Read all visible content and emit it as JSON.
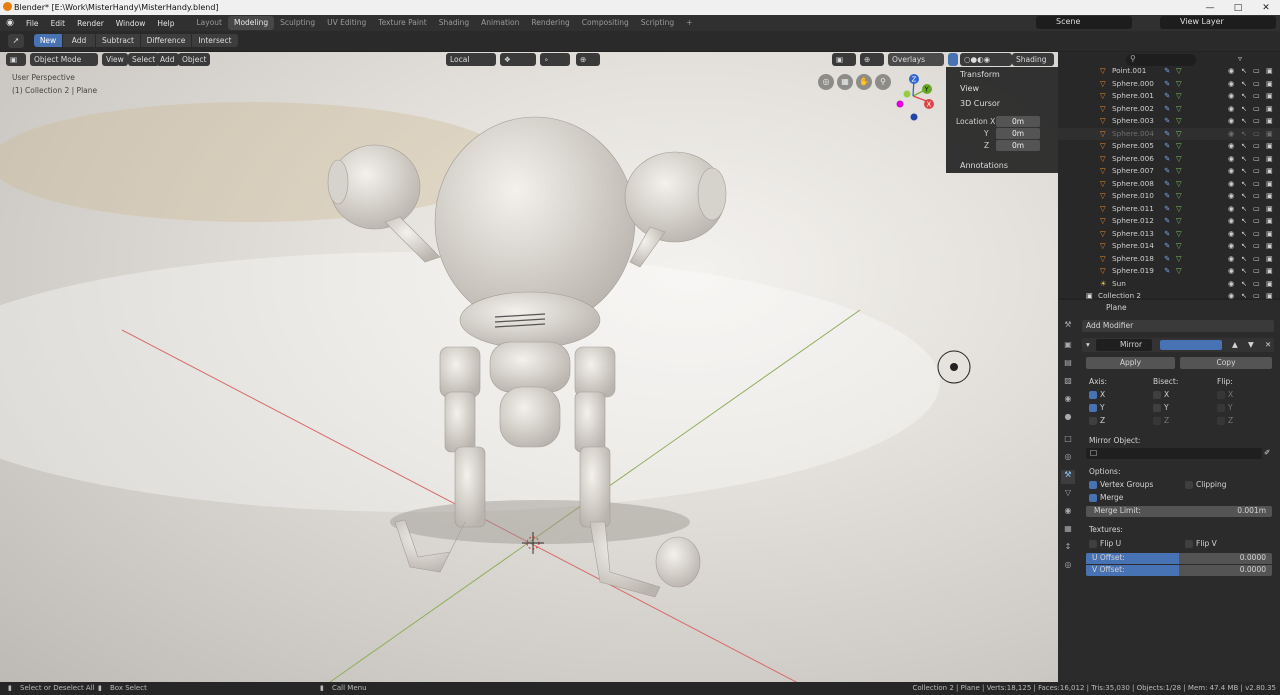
{
  "title": "Blender* [E:\\Work\\MisterHandy\\MisterHandy.blend]",
  "menus": [
    "File",
    "Edit",
    "Render",
    "Window",
    "Help"
  ],
  "workspaces": [
    "Layout",
    "Modeling",
    "Sculpting",
    "UV Editing",
    "Texture Paint",
    "Shading",
    "Animation",
    "Rendering",
    "Compositing",
    "Scripting"
  ],
  "active_workspace": "Modeling",
  "scene": "Scene",
  "view_layer": "View Layer",
  "boolean_tools": [
    "New",
    "Add",
    "Subtract",
    "Difference",
    "Intersect"
  ],
  "viewport": {
    "mode": "Object Mode",
    "menus": [
      "View",
      "Select",
      "Add",
      "Object"
    ],
    "orientation": "Local",
    "overlays": "Overlays",
    "shading": "Shading",
    "info_line1": "User Perspective",
    "info_line2": "(1) Collection 2 | Plane",
    "gizmo_axes": [
      "X",
      "Y",
      "Z"
    ]
  },
  "npanel": {
    "transform": "Transform",
    "view": "View",
    "cursor": "3D Cursor",
    "loc_label": "Location X",
    "y": "Y",
    "z": "Z",
    "loc_x": "0m",
    "loc_y": "0m",
    "loc_z": "0m",
    "annotations": "Annotations"
  },
  "outliner": {
    "items": [
      "Point.001",
      "Sphere.000",
      "Sphere.001",
      "Sphere.002",
      "Sphere.003",
      "Sphere.004",
      "Sphere.005",
      "Sphere.006",
      "Sphere.007",
      "Sphere.008",
      "Sphere.010",
      "Sphere.011",
      "Sphere.012",
      "Sphere.013",
      "Sphere.014",
      "Sphere.018",
      "Sphere.019",
      "Sun",
      "Collection 2"
    ]
  },
  "properties": {
    "object": "Plane",
    "add_modifier": "Add Modifier",
    "modifier_name": "Mirror",
    "apply": "Apply",
    "copy": "Copy",
    "axis": "Axis:",
    "bisect": "Bisect:",
    "flip": "Flip:",
    "x": "X",
    "y": "Y",
    "z": "Z",
    "mirror_object": "Mirror Object:",
    "options": "Options:",
    "vertex_groups": "Vertex Groups",
    "clipping": "Clipping",
    "merge": "Merge",
    "merge_limit_label": "Merge Limit:",
    "merge_limit": "0.001m",
    "textures": "Textures:",
    "flip_u": "Flip U",
    "flip_v": "Flip V",
    "u_offset_label": "U Offset:",
    "u_offset": "0.0000",
    "v_offset_label": "V Offset:",
    "v_offset": "0.0000"
  },
  "status": {
    "left1": "Select or Deselect All",
    "left2": "Box Select",
    "mid": "Call Menu",
    "right": "Collection 2 | Plane | Verts:18,125 | Faces:16,012 | Tris:35,030 | Objects:1/28 | Mem: 47.4 MB | v2.80.35"
  },
  "colors": {
    "accent": "#4772b3",
    "mesh_icon": "#e88a2e",
    "header": "#303030"
  }
}
